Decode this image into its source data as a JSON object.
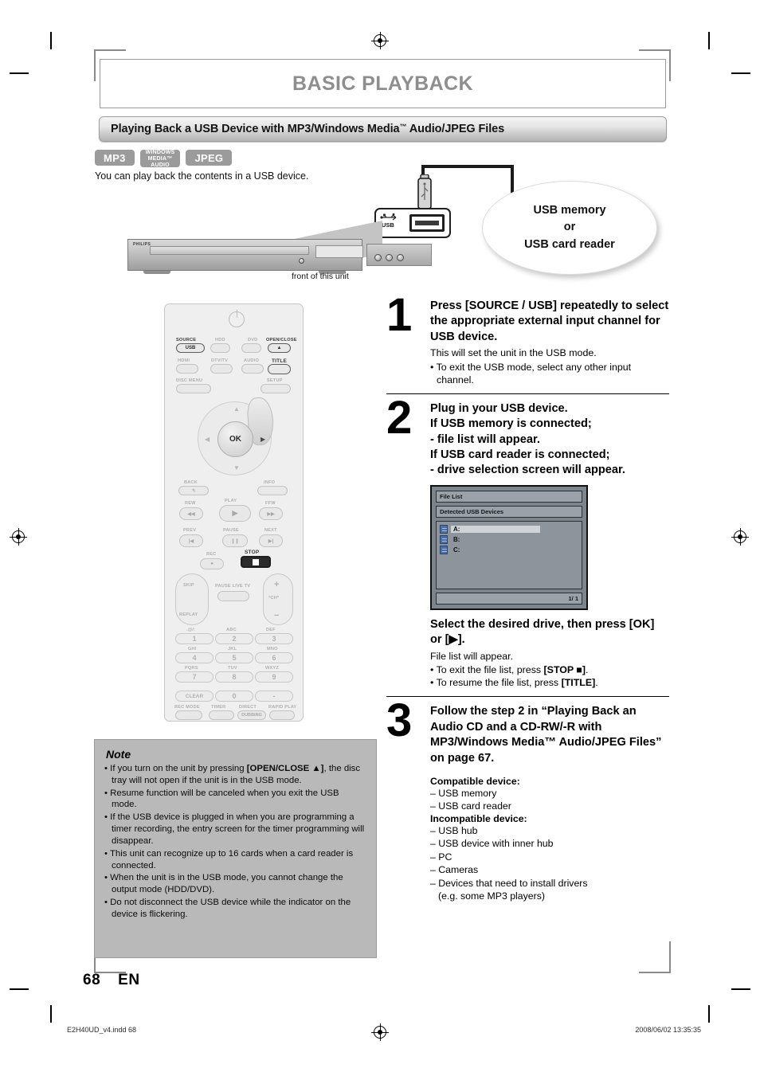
{
  "chapter": {
    "title": "BASIC PLAYBACK"
  },
  "section": {
    "title_pre": "Playing Back a USB Device with MP3/Windows Media",
    "title_tm": "™",
    "title_post": " Audio/JPEG Files"
  },
  "badges": [
    {
      "name": "mp3",
      "label": "MP3",
      "lines": [
        "MP3"
      ]
    },
    {
      "name": "windows-media-audio",
      "label": "WINDOWS MEDIA™ AUDIO",
      "lines": [
        "WINDOWS",
        "MEDIA™",
        "AUDIO"
      ]
    },
    {
      "name": "jpeg",
      "label": "JPEG",
      "lines": [
        "JPEG"
      ]
    }
  ],
  "intro": "You can play back the contents in a USB device.",
  "diagram": {
    "usb_port_label": "USB",
    "bubble_lines": [
      "USB memory",
      "or",
      "USB card reader"
    ],
    "unit_caption": "front of this unit",
    "unit_brand": "PHILIPS"
  },
  "remote": {
    "labels": {
      "source": "SOURCE",
      "hdd": "HDD",
      "dvd": "DVD",
      "open_close": "OPEN/CLOSE",
      "hdmi": "HDMI",
      "dtv_tv": "DTV/TV",
      "audio": "AUDIO",
      "title": "TITLE",
      "disc_menu": "DISC MENU",
      "setup": "SETUP",
      "usb": "USB",
      "ok": "OK",
      "back": "BACK",
      "info": "INFO",
      "rew": "REW",
      "play": "PLAY",
      "ffw": "FFW",
      "prev": "PREV",
      "pause": "PAUSE",
      "next": "NEXT",
      "rec": "REC",
      "stop": "STOP",
      "skip": "SKIP",
      "replay": "REPLAY",
      "pause_live_tv": "PAUSE LIVE TV",
      "ch": "*CH*",
      "clear": "CLEAR",
      "rec_mode": "REC MODE",
      "timer": "TIMER",
      "direct": "DIRECT",
      "dubbing": "DUBBING",
      "rapid_play": "RAPID PLAY"
    },
    "keypad": [
      {
        "sub": ".@/:",
        "digit": "1"
      },
      {
        "sub": "ABC",
        "digit": "2"
      },
      {
        "sub": "DEF",
        "digit": "3"
      },
      {
        "sub": "GHI",
        "digit": "4"
      },
      {
        "sub": "JKL",
        "digit": "5"
      },
      {
        "sub": "MNO",
        "digit": "6"
      },
      {
        "sub": "PQRS",
        "digit": "7"
      },
      {
        "sub": "TUV",
        "digit": "8"
      },
      {
        "sub": "WXYZ",
        "digit": "9"
      },
      {
        "sub": "",
        "digit": "0"
      },
      {
        "sub": "",
        "digit": "-"
      }
    ]
  },
  "steps": {
    "step1": {
      "number": "1",
      "heading": "Press [SOURCE / USB] repeatedly to select the appropriate external input channel for USB device.",
      "sub": "This will set the unit in the USB mode.",
      "bullets": [
        "To exit the USB mode, select any other input channel."
      ]
    },
    "step2": {
      "number": "2",
      "heading_lines": [
        "Plug in your USB device.",
        "If USB memory is connected;",
        "- file list will appear.",
        "If USB card reader is connected;",
        "- drive selection screen will appear."
      ],
      "sub_heading": "Select the desired drive, then press [OK] or [▶].",
      "sub": "File list will appear.",
      "bullets": [
        "To exit the file list, press [STOP ■].",
        "To resume the file list, press [TITLE]."
      ]
    },
    "step3": {
      "number": "3",
      "heading": "Follow the step 2 in “Playing Back an Audio CD and a CD-RW/-R with MP3/Windows Media™ Audio/JPEG Files” on page 67.",
      "compatible_title": "Compatible device:",
      "compatible": [
        "– USB memory",
        "– USB card reader"
      ],
      "incompatible_title": "Incompatible device:",
      "incompatible": [
        "– USB hub",
        "– USB device with inner hub",
        "– PC",
        "– Cameras",
        "– Devices that need to install drivers"
      ],
      "incompatible_cont": "(e.g. some MP3 players)"
    }
  },
  "file_list_screen": {
    "title": "File List",
    "subtitle": "Detected USB Devices",
    "rows": [
      "A:",
      "B:",
      "C:"
    ],
    "selected_index": 0,
    "page_indicator": "1/ 1"
  },
  "note": {
    "title": "Note",
    "items": [
      "If you turn on the unit by pressing [OPEN/CLOSE ▲], the disc tray will not open if the unit is in the USB mode.",
      "Resume function will be canceled when you exit the USB mode.",
      "If the USB device is plugged in when you are programming a timer recording, the entry screen for the timer programming will disappear.",
      "This unit can recognize up to 16 cards when a card reader is connected.",
      "When the unit is in the USB mode, you cannot change the output mode (HDD/DVD).",
      "Do not disconnect the USB device while the indicator on the device is flickering."
    ]
  },
  "footer": {
    "page_number": "68",
    "language": "EN",
    "file_name": "E2H40UD_v4.indd   68",
    "timestamp": "2008/06/02   13:35:35"
  }
}
